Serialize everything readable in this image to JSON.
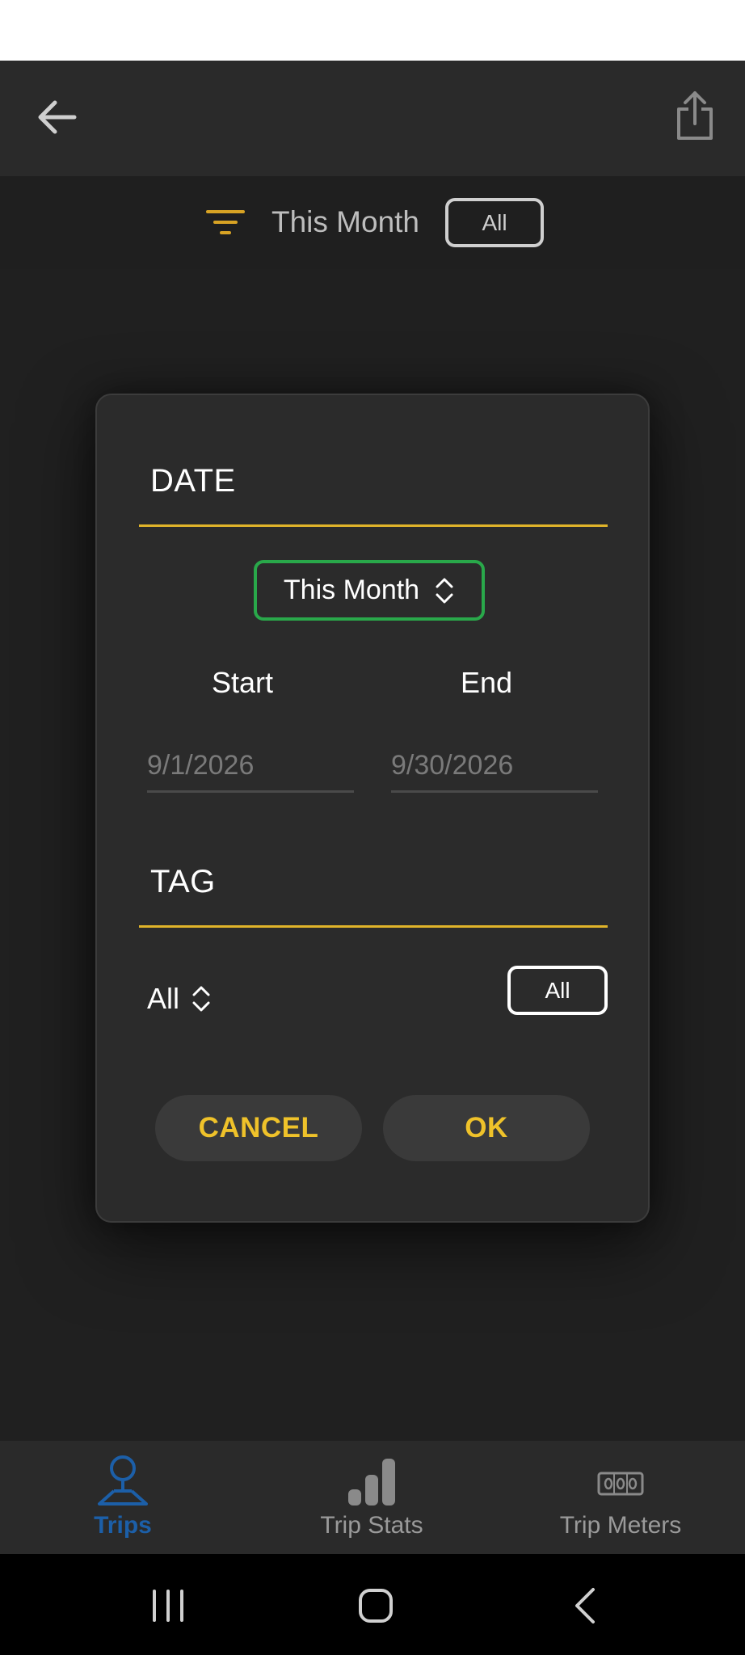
{
  "header": {
    "back_icon": "arrow-left-icon",
    "share_icon": "share-icon"
  },
  "filter_bar": {
    "icon": "filter-icon",
    "date_label": "This Month",
    "tag_label": "All"
  },
  "dialog": {
    "date_section_title": "DATE",
    "range_value": "This Month",
    "start_label": "Start",
    "end_label": "End",
    "start_placeholder": "9/1/2026",
    "end_placeholder": "9/30/2026",
    "tag_section_title": "TAG",
    "tag_value": "All",
    "tag_pill_label": "All",
    "cancel_label": "CANCEL",
    "ok_label": "OK"
  },
  "bottom_nav": {
    "items": [
      {
        "label": "Trips",
        "icon": "trips-pin-icon",
        "active": true
      },
      {
        "label": "Trip Stats",
        "icon": "bar-chart-icon",
        "active": false
      },
      {
        "label": "Trip Meters",
        "icon": "odometer-icon",
        "active": false
      }
    ]
  },
  "colors": {
    "accent_yellow": "#e0b42a",
    "button_text": "#efc22a",
    "select_border_green": "#29a84a",
    "active_nav_blue": "#1c5fa8",
    "background": "#1f1f1f",
    "surface": "#2b2b2b"
  }
}
